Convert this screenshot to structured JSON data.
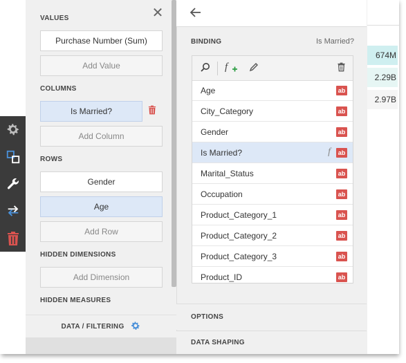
{
  "background_grid": {
    "cells": [
      "674M",
      "2.29B",
      "2.97B"
    ]
  },
  "toolbar": {
    "items": [
      "gear-icon",
      "swap-panels-icon",
      "wrench-icon",
      "arrows-icon",
      "trash-icon"
    ]
  },
  "panel1": {
    "values_heading": "VALUES",
    "values_field": "Purchase Number (Sum)",
    "add_value": "Add Value",
    "columns_heading": "COLUMNS",
    "columns_field": "Is Married?",
    "add_column": "Add Column",
    "rows_heading": "ROWS",
    "rows_fields": [
      "Gender",
      "Age"
    ],
    "add_row": "Add Row",
    "hidden_dimensions_heading": "HIDDEN DIMENSIONS",
    "add_dimension": "Add Dimension",
    "hidden_measures_heading": "HIDDEN MEASURES",
    "footer_label": "DATA / FILTERING"
  },
  "panel2": {
    "binding_heading": "BINDING",
    "binding_field": "Is Married?",
    "type_badge": "ab",
    "fields": [
      "Age",
      "City_Category",
      "Gender",
      "Is Married?",
      "Marital_Status",
      "Occupation",
      "Product_Category_1",
      "Product_Category_2",
      "Product_Category_3",
      "Product_ID"
    ],
    "selected_field": "Is Married?",
    "options_heading": "OPTIONS",
    "data_shaping_heading": "DATA SHAPING"
  },
  "colors": {
    "accent_red": "#d9534f",
    "selection_blue": "#dde8f7",
    "toolbar_dark": "#3b3b3b",
    "icon_blue": "#4a90d9"
  }
}
